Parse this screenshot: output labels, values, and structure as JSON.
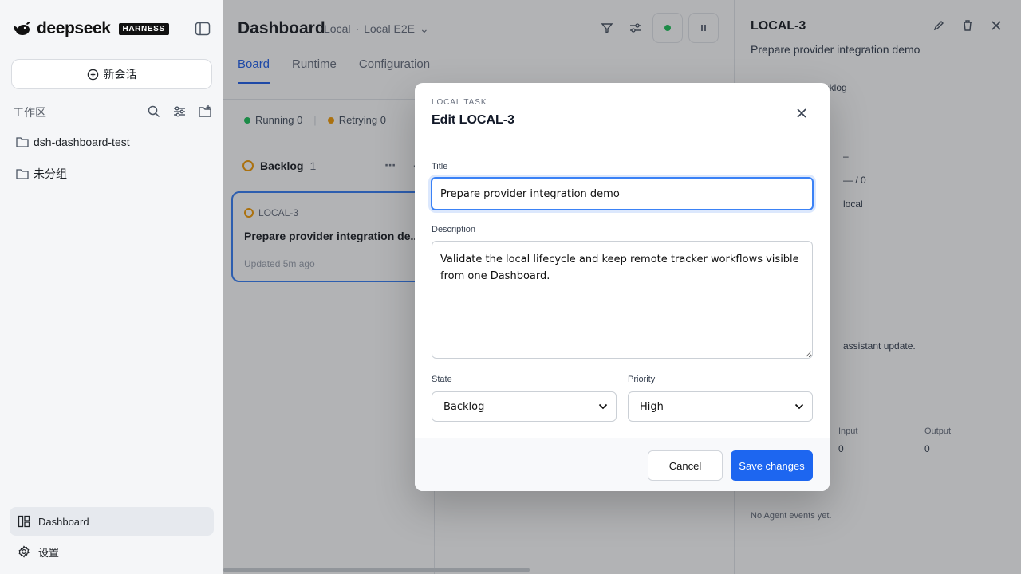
{
  "sidebar": {
    "brand_name": "deepseek",
    "brand_tag": "HARNESS",
    "new_chat_label": "新会话",
    "workspace_label": "工作区",
    "groups": [
      {
        "label": "dsh-dashboard-test"
      },
      {
        "label": "未分组"
      }
    ],
    "bottom": {
      "dashboard_label": "Dashboard",
      "settings_label": "设置"
    }
  },
  "main": {
    "title": "Dashboard",
    "crumb_env": "Local",
    "crumb_sep": "·",
    "crumb_project": "Local E2E",
    "tabs": [
      {
        "label": "Board",
        "active": true
      },
      {
        "label": "Runtime",
        "active": false
      },
      {
        "label": "Configuration",
        "active": false
      }
    ],
    "status": [
      {
        "label": "Running",
        "count": "0",
        "color": "#22c55e"
      },
      {
        "label": "Retrying",
        "count": "0",
        "color": "#f59e0b"
      }
    ],
    "column": {
      "name": "Backlog",
      "count": "1"
    },
    "card": {
      "id": "LOCAL-3",
      "title": "Prepare provider integration de...",
      "updated": "Updated 5m ago"
    }
  },
  "detail": {
    "id": "LOCAL-3",
    "title": "Prepare provider integration demo",
    "state": "Backlog",
    "dash": "–",
    "ratio": "— / 0",
    "source": "local",
    "update_text": "assistant update.",
    "input_label": "Input",
    "output_label": "Output",
    "input_value": "0",
    "output_value": "0",
    "events_empty": "No Agent events yet."
  },
  "modal": {
    "eyebrow": "LOCAL TASK",
    "title": "Edit LOCAL-3",
    "title_label": "Title",
    "title_value": "Prepare provider integration demo",
    "description_label": "Description",
    "description_value": "Validate the local lifecycle and keep remote tracker workflows visible from one Dashboard.",
    "state_label": "State",
    "state_value": "Backlog",
    "priority_label": "Priority",
    "priority_value": "High",
    "cancel_label": "Cancel",
    "save_label": "Save changes"
  },
  "colors": {
    "accent": "#1d66f0",
    "focus": "#3b82f6",
    "running": "#22c55e",
    "retrying": "#f59e0b"
  }
}
